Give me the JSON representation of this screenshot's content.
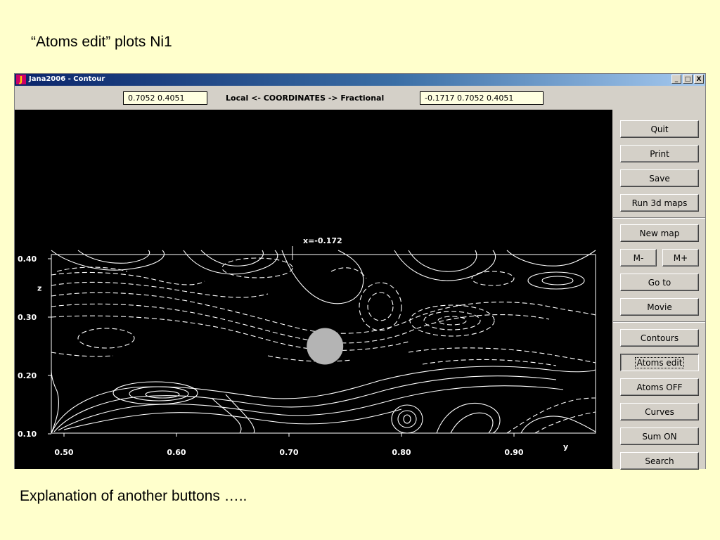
{
  "slide": {
    "title": "“Atoms edit” plots Ni1",
    "footer": "Explanation of another buttons ….."
  },
  "window": {
    "title": "Jana2006 - Contour",
    "icon_letter": "J",
    "controls": [
      "_",
      "□",
      "X"
    ]
  },
  "coords": {
    "local_value": "0.7052 0.4051",
    "label": "Local <- COORDINATES -> Fractional",
    "fractional_value": "-0.1717 0.7052 0.4051"
  },
  "plot": {
    "x_marker_label": "x=-0.172",
    "x_axis_label": "y",
    "y_axis_label": "z",
    "x_ticks": [
      "0.50",
      "0.60",
      "0.70",
      "0.80",
      "0.90"
    ],
    "y_ticks": [
      "0.40",
      "0.30",
      "0.20",
      "0.10"
    ],
    "atom": {
      "y": 0.732,
      "z": 0.25,
      "color": "#b4b4b4"
    }
  },
  "buttons": {
    "quit": "Quit",
    "print": "Print",
    "save": "Save",
    "run3d": "Run 3d maps",
    "new_map": "New map",
    "m_minus": "M-",
    "m_plus": "M+",
    "goto": "Go to",
    "movie": "Movie",
    "contours": "Contours",
    "atoms_edit": "Atoms edit",
    "atoms_off": "Atoms OFF",
    "curves": "Curves",
    "sum_on": "Sum ON",
    "search": "Search"
  },
  "colors": {
    "slide_bg": "#ffffcc",
    "plot_bg": "#000000",
    "contour": "#ffffff",
    "field_bg": "#ffffe1"
  }
}
